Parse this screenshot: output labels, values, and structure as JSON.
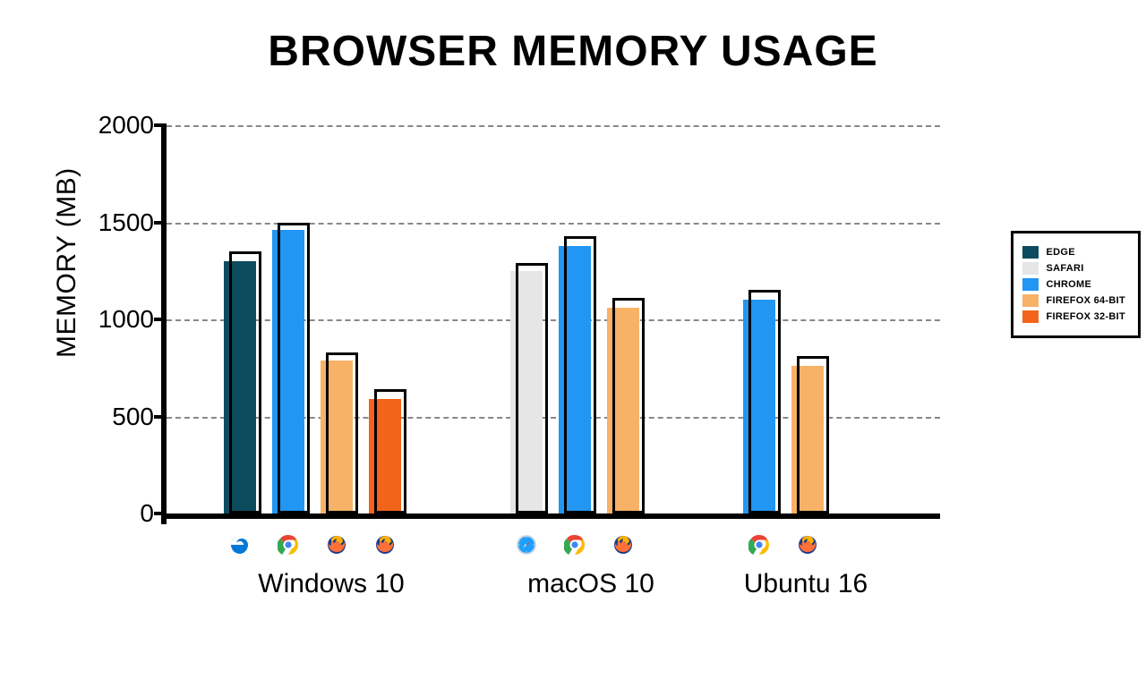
{
  "chart_data": {
    "type": "bar",
    "title": "BROWSER MEMORY USAGE",
    "ylabel": "MEMORY (MB)",
    "ylim": [
      0,
      2000
    ],
    "yticks": [
      0,
      500,
      1000,
      1500,
      2000
    ],
    "categories": [
      "Windows 10",
      "macOS 10",
      "Ubuntu 16"
    ],
    "series": [
      {
        "name": "EDGE",
        "color": "#0d4b5f",
        "values": [
          1300,
          null,
          null
        ],
        "outline": [
          1350,
          null,
          null
        ]
      },
      {
        "name": "SAFARI",
        "color": "#e6e6e6",
        "values": [
          null,
          1250,
          null
        ],
        "outline": [
          null,
          1290,
          null
        ]
      },
      {
        "name": "CHROME",
        "color": "#2196f3",
        "values": [
          1460,
          1380,
          1100
        ],
        "outline": [
          1500,
          1430,
          1150
        ]
      },
      {
        "name": "FIREFOX 64-BIT",
        "color": "#f7b267",
        "values": [
          790,
          1060,
          760
        ],
        "outline": [
          830,
          1110,
          810
        ]
      },
      {
        "name": "FIREFOX 32-BIT",
        "color": "#f26419",
        "values": [
          590,
          null,
          null
        ],
        "outline": [
          640,
          null,
          null
        ]
      }
    ],
    "group_icons": [
      [
        "edge",
        "chrome",
        "firefox",
        "firefox"
      ],
      [
        "safari",
        "chrome",
        "firefox"
      ],
      [
        "chrome",
        "firefox"
      ]
    ],
    "legend": [
      "EDGE",
      "SAFARI",
      "CHROME",
      "FIREFOX 64-BIT",
      "FIREFOX 32-BIT"
    ]
  }
}
